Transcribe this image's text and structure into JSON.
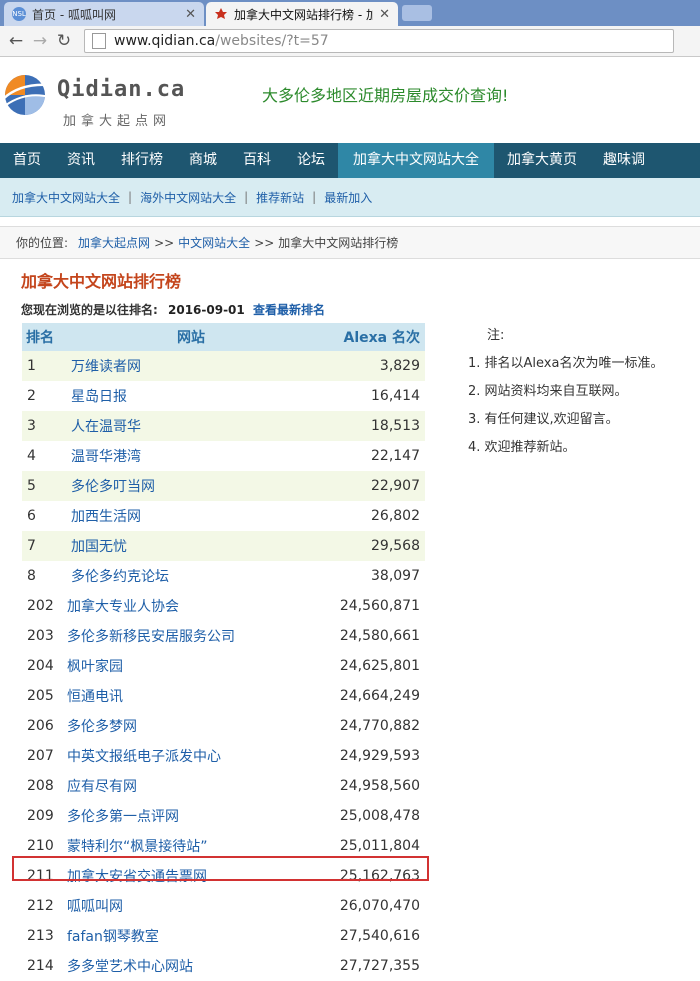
{
  "browser": {
    "tabs": [
      {
        "title": "首页 - 呱呱叫网",
        "active": false
      },
      {
        "title": "加拿大中文网站排行榜 - 加",
        "active": true
      }
    ],
    "url_host": "www.qidian.ca",
    "url_rest": "/websites/?t=57"
  },
  "site": {
    "logo_text": "Qidian.ca",
    "logo_sub": "加拿大起点网",
    "banner": "大多伦多地区近期房屋成交价查询!"
  },
  "nav": {
    "main": [
      "首页",
      "资讯",
      "排行榜",
      "商城",
      "百科",
      "论坛",
      "加拿大中文网站大全",
      "加拿大黄页",
      "趣味调"
    ],
    "active_index": 6,
    "sub": [
      "加拿大中文网站大全",
      "海外中文网站大全",
      "推荐新站",
      "最新加入"
    ]
  },
  "breadcrumb": {
    "label": "你的位置:",
    "items": [
      "加拿大起点网",
      "中文网站大全",
      "加拿大中文网站排行榜"
    ],
    "sep": ">>"
  },
  "page": {
    "title": "加拿大中文网站排行榜",
    "history_text": "您现在浏览的是以往排名:",
    "history_date": "2016-09-01",
    "history_link": "查看最新排名"
  },
  "table": {
    "headers": [
      "排名",
      "网站",
      "Alexa 名次"
    ],
    "rows": [
      {
        "rank": "1",
        "name": "万维读者网",
        "alexa": "3,829"
      },
      {
        "rank": "2",
        "name": "星岛日报",
        "alexa": "16,414"
      },
      {
        "rank": "3",
        "name": "人在温哥华",
        "alexa": "18,513"
      },
      {
        "rank": "4",
        "name": "温哥华港湾",
        "alexa": "22,147"
      },
      {
        "rank": "5",
        "name": "多伦多叮当网",
        "alexa": "22,907"
      },
      {
        "rank": "6",
        "name": "加西生活网",
        "alexa": "26,802"
      },
      {
        "rank": "7",
        "name": "加国无忧",
        "alexa": "29,568"
      },
      {
        "rank": "8",
        "name": "多伦多约克论坛",
        "alexa": "38,097"
      },
      {
        "rank": "202",
        "name": "加拿大专业人协会",
        "alexa": "24,560,871"
      },
      {
        "rank": "203",
        "name": "多伦多新移民安居服务公司",
        "alexa": "24,580,661"
      },
      {
        "rank": "204",
        "name": "枫叶家园",
        "alexa": "24,625,801"
      },
      {
        "rank": "205",
        "name": "恒通电讯",
        "alexa": "24,664,249"
      },
      {
        "rank": "206",
        "name": "多伦多梦网",
        "alexa": "24,770,882"
      },
      {
        "rank": "207",
        "name": "中英文报纸电子派发中心",
        "alexa": "24,929,593"
      },
      {
        "rank": "208",
        "name": "应有尽有网",
        "alexa": "24,958,560"
      },
      {
        "rank": "209",
        "name": "多伦多第一点评网",
        "alexa": "25,008,478"
      },
      {
        "rank": "210",
        "name": "蒙特利尔“枫景接待站”",
        "alexa": "25,011,804"
      },
      {
        "rank": "211",
        "name": "加拿大安省交通告票网",
        "alexa": "25,162,763"
      },
      {
        "rank": "212",
        "name": "呱呱叫网",
        "alexa": "26,070,470"
      },
      {
        "rank": "213",
        "name": "fafan钢琴教室",
        "alexa": "27,540,616"
      },
      {
        "rank": "214",
        "name": "多多堂艺术中心网站",
        "alexa": "27,727,355"
      }
    ]
  },
  "notes": {
    "heading": "注:",
    "items": [
      "1. 排名以Alexa名次为唯一标准。",
      "2. 网站资料均来自互联网。",
      "3. 有任何建议,欢迎留言。",
      "4. 欢迎推荐新站。"
    ]
  },
  "colors": {
    "nav_bg": "#1e5670",
    "nav_active": "#2f87a6",
    "title": "#c4451c",
    "link": "#1f5fa8",
    "highlight_border": "#d23232"
  }
}
